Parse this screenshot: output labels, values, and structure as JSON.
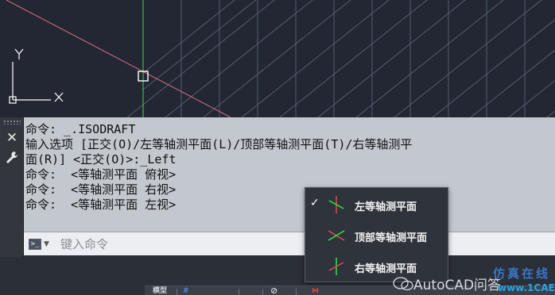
{
  "canvas": {
    "axis_y_label": "Y",
    "axis_x_label": "X",
    "crosshair_color": "#2ee640",
    "isoline_color": "#e0788c",
    "grid_color": "#5a6272"
  },
  "command_window": {
    "close_icon": "close-icon",
    "settings_icon": "wrench-icon",
    "history": [
      "命令: _.ISODRAFT",
      "输入选项 [正交(O)/左等轴测平面(L)/顶部等轴测平面(T)/右等轴测平",
      "面(R)] <正交(O)>:_Left",
      "命令:  <等轴测平面 俯视>",
      "命令:  <等轴测平面 右视>",
      "命令:  <等轴测平面 左视>"
    ],
    "prompt_icon": ">_",
    "input_placeholder": "键入命令",
    "input_value": ""
  },
  "isoplane_menu": {
    "items": [
      {
        "label": "左等轴测平面",
        "checked": true,
        "icon": "isoplane-left-icon"
      },
      {
        "label": "顶部等轴测平面",
        "checked": false,
        "icon": "isoplane-top-icon"
      },
      {
        "label": "右等轴测平面",
        "checked": false,
        "icon": "isoplane-right-icon"
      }
    ],
    "check_mark": "✓"
  },
  "statusbar": {
    "model_label": "模型",
    "grid_label": "#"
  },
  "watermark": {
    "logo_text": "AutoCAD问答",
    "blue_text": "仿真在线",
    "site": "www.1CAE.com"
  }
}
